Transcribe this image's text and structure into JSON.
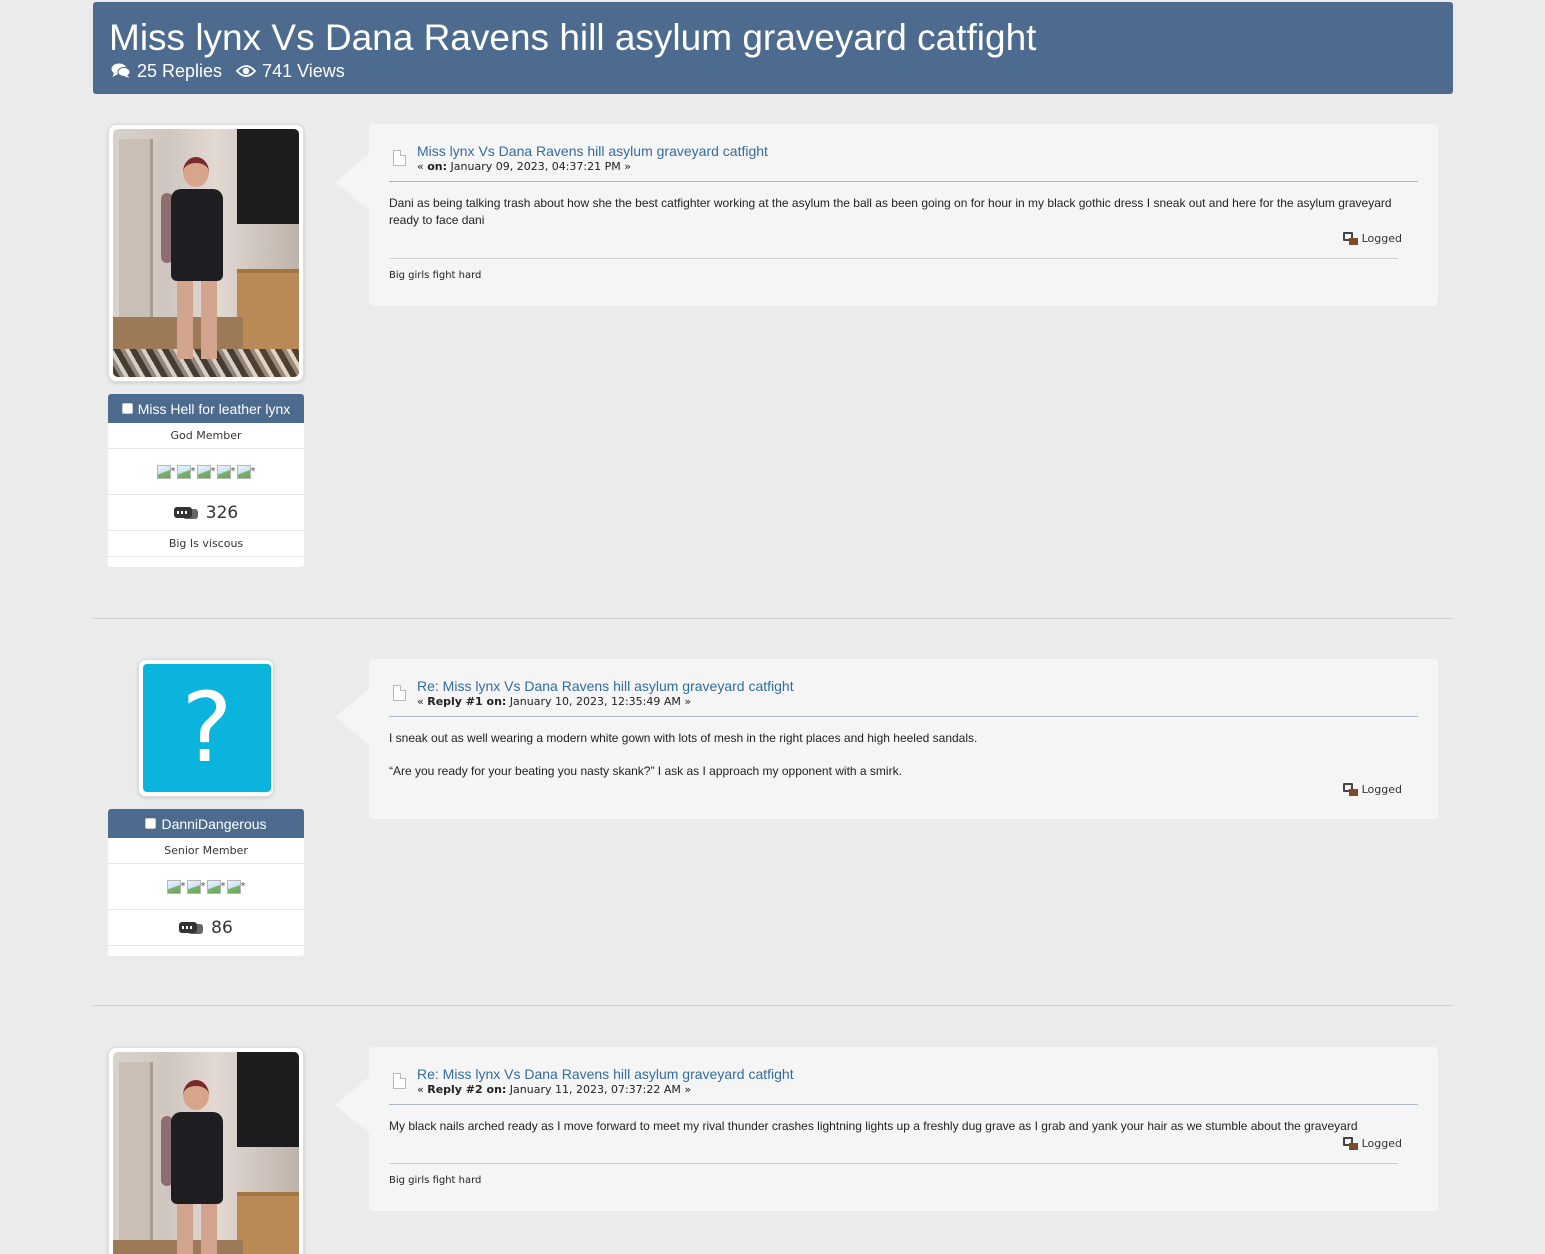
{
  "topic": {
    "title": "Miss lynx Vs Dana Ravens hill asylum graveyard catfight",
    "replies": "25 Replies",
    "views": "741 Views"
  },
  "posts": [
    {
      "poster": {
        "name": "Miss Hell for leather lynx",
        "group": "God Member",
        "stars": [
          "*",
          "*",
          "*",
          "*",
          "*"
        ],
        "post_count": "326",
        "custom_title": "Big Is viscous",
        "avatar": "photo-avatar"
      },
      "subject": "Miss lynx Vs Dana Ravens hill asylum graveyard catfight",
      "meta_prefix": "« ",
      "meta_label": "on:",
      "meta_date": " January 09, 2023, 04:37:21 PM »",
      "body": [
        "Dani as being talking trash about how she the best catfighter working at the asylum the ball as been going on for hour in my black gothic dress I sneak out and here for the asylum graveyard ready to face dani"
      ],
      "logged": "Logged",
      "signature": "Big girls fight hard"
    },
    {
      "poster": {
        "name": "DanniDangerous",
        "group": "Senior Member",
        "stars": [
          "*",
          "*",
          "*",
          "*"
        ],
        "post_count": "86",
        "avatar": "question-mark-avatar",
        "avatar_glyph": "?"
      },
      "subject": "Re: Miss lynx Vs Dana Ravens hill asylum graveyard catfight",
      "meta_prefix": "« ",
      "meta_label": "Reply #1 on:",
      "meta_date": " January 10, 2023, 12:35:49 AM »",
      "body": [
        "I sneak out as well wearing a modern white gown with lots of mesh in the right places and high heeled sandals.",
        "“Are you ready for your beating you nasty skank?” I ask as I approach my opponent with a smirk."
      ],
      "logged": "Logged"
    },
    {
      "poster": {
        "avatar": "photo-avatar"
      },
      "subject": "Re: Miss lynx Vs Dana Ravens hill asylum graveyard catfight",
      "meta_prefix": "« ",
      "meta_label": "Reply #2 on:",
      "meta_date": " January 11, 2023, 07:37:22 AM »",
      "body": [
        "My black nails arched ready as I move forward to meet my rival thunder crashes lightning lights up a freshly dug grave as I grab and yank your hair as we stumble about the graveyard"
      ],
      "logged": "Logged",
      "signature": "Big girls fight hard"
    }
  ],
  "colors": {
    "header_bg": "#4d6a8f",
    "link": "#346b9e",
    "page_bg": "#ebebeb",
    "card_bg": "#f6f5f6",
    "avatar_q_bg": "#0bb4dd"
  }
}
